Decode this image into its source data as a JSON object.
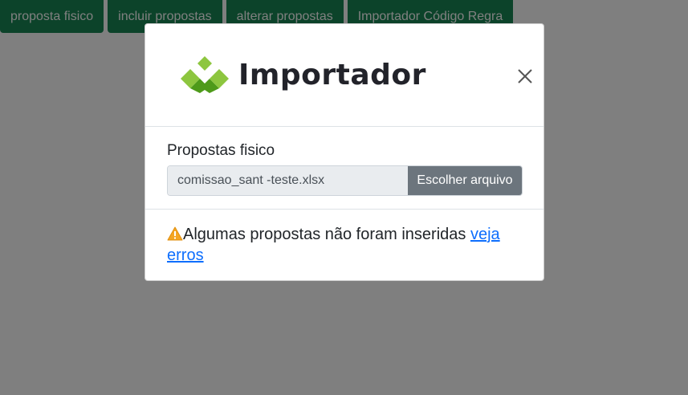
{
  "toolbar": {
    "buttons": [
      {
        "label": "proposta fisico"
      },
      {
        "label": "incluir propostas"
      },
      {
        "label": "alterar propostas"
      },
      {
        "label": "Importador Código Regra"
      }
    ]
  },
  "modal": {
    "logo_text": "Importador",
    "logo_icon": "importador-logo-icon",
    "close_icon": "close-icon",
    "body": {
      "field_label": "Propostas fisico",
      "file_name": "comissao_sant -teste.xlsx",
      "choose_button_label": "Escolher arquivo"
    },
    "footer": {
      "warning_icon": "warning-icon",
      "message": "Algumas propostas não foram inseridas ",
      "link_text": "veja erros"
    }
  },
  "colors": {
    "toolbar_button": "#198754",
    "backdrop": "rgba(0,0,0,0.5)",
    "logo_green_light": "#8dc63f",
    "logo_green_dark": "#4e9a1a",
    "file_button": "#6c757d",
    "link": "#0d6efd",
    "warning": "#f5a623"
  }
}
